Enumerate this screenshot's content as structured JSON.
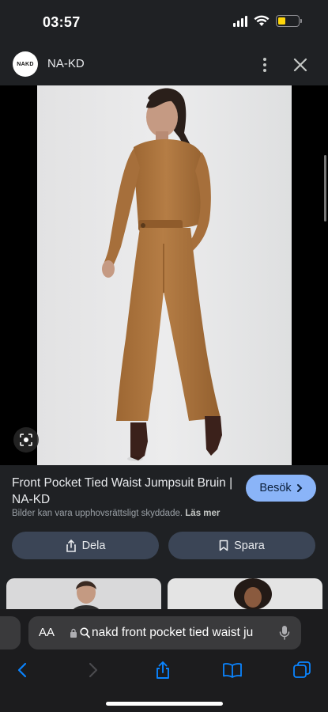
{
  "status_bar": {
    "time": "03:57"
  },
  "header": {
    "logo_text": "NAKD",
    "site_name": "NA-KD"
  },
  "result": {
    "title": "Front Pocket Tied Waist Jumpsuit Bruin | NA-KD",
    "visit_label": "Besök",
    "copyright_notice": "Bilder kan vara upphovsrättsligt skyddade.",
    "read_more": "Läs mer",
    "share_label": "Dela",
    "save_label": "Spara"
  },
  "browser": {
    "aa_label": "AA",
    "url_text": "nakd front pocket tied waist ju"
  },
  "colors": {
    "visit_button": "#8ab4f8",
    "action_button": "#3b4556",
    "battery": "#ffd60a",
    "toolbar_icon": "#0a84ff",
    "jumpsuit": "#b07a44"
  }
}
